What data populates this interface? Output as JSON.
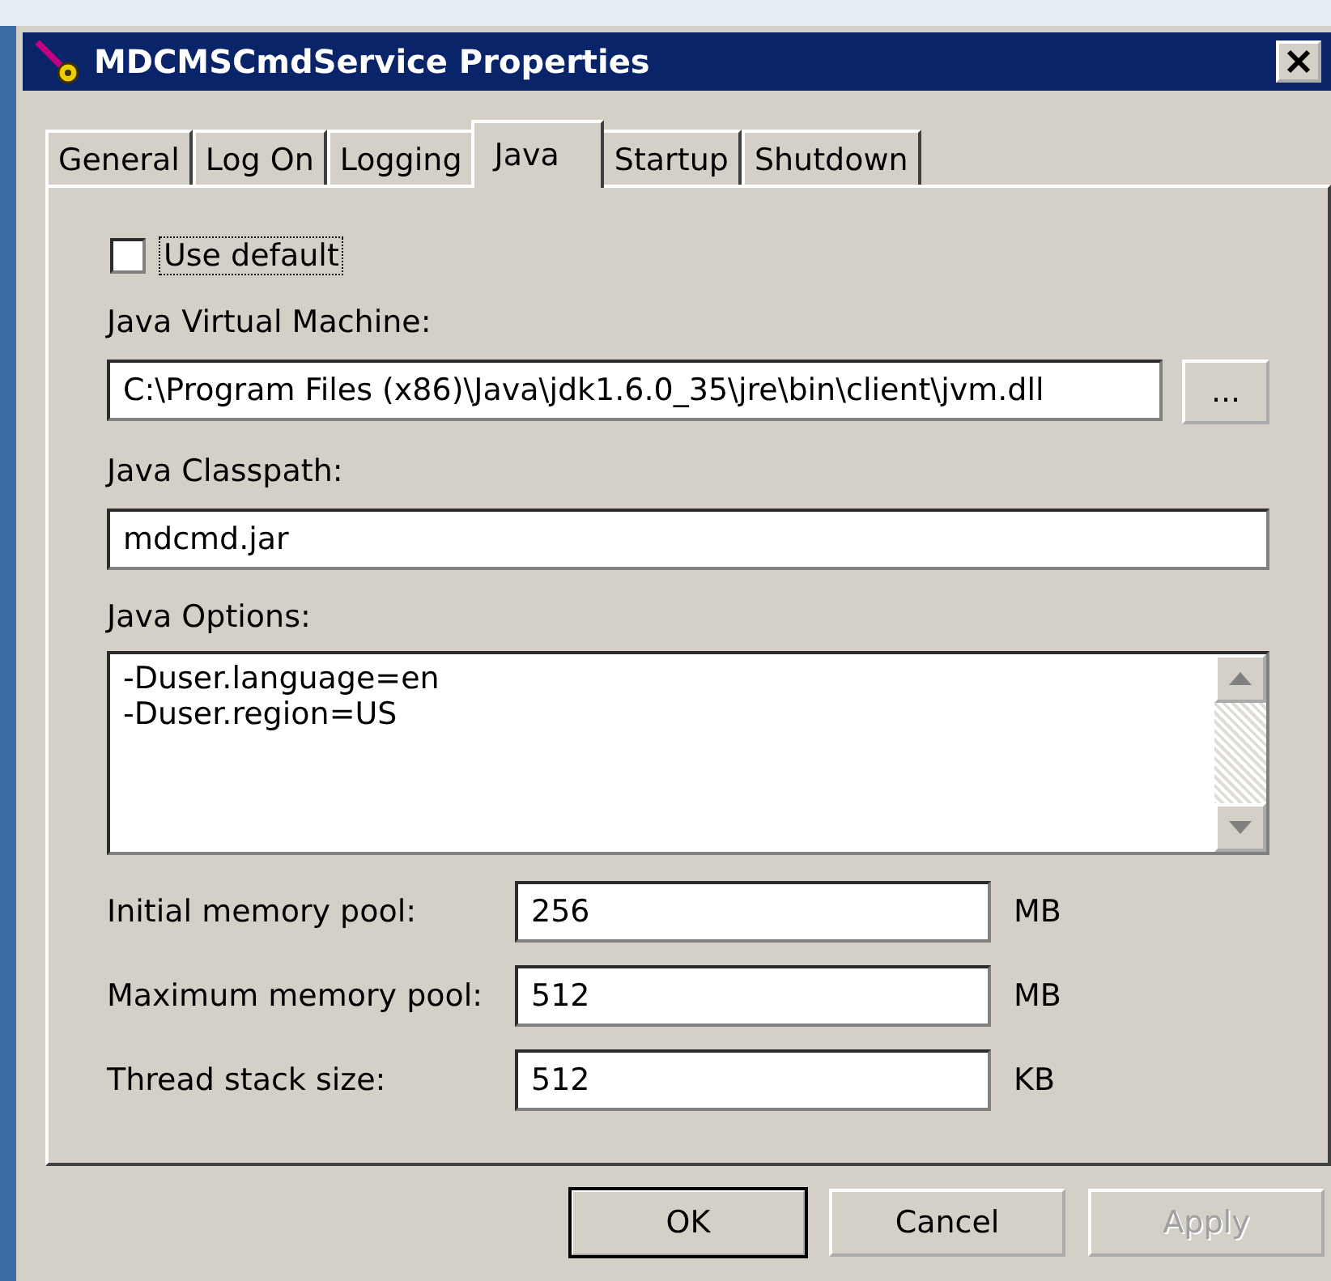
{
  "window": {
    "title": "MDCMSCmdService Properties"
  },
  "tabs": [
    {
      "label": "General",
      "selected": false
    },
    {
      "label": "Log On",
      "selected": false
    },
    {
      "label": "Logging",
      "selected": false
    },
    {
      "label": "Java",
      "selected": true
    },
    {
      "label": "Startup",
      "selected": false
    },
    {
      "label": "Shutdown",
      "selected": false
    }
  ],
  "use_default": {
    "label": "Use default",
    "checked": false
  },
  "jvm": {
    "label": "Java Virtual Machine:",
    "value": "C:\\Program Files (x86)\\Java\\jdk1.6.0_35\\jre\\bin\\client\\jvm.dll",
    "browse": "..."
  },
  "classpath": {
    "label": "Java Classpath:",
    "value": "mdcmd.jar"
  },
  "options": {
    "label": "Java Options:",
    "lines": [
      "-Duser.language=en",
      "-Duser.region=US"
    ]
  },
  "memory": [
    {
      "label": "Initial memory pool:",
      "value": "256",
      "unit": "MB"
    },
    {
      "label": "Maximum memory pool:",
      "value": "512",
      "unit": "MB"
    },
    {
      "label": "Thread stack size:",
      "value": "512",
      "unit": "KB"
    }
  ],
  "buttons": [
    {
      "label": "OK",
      "disabled": false,
      "default": true
    },
    {
      "label": "Cancel",
      "disabled": false,
      "default": false
    },
    {
      "label": "Apply",
      "disabled": true,
      "default": false
    }
  ]
}
